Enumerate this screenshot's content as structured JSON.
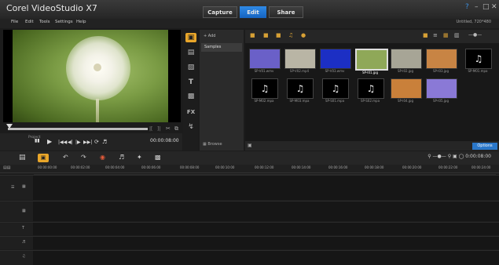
{
  "app": {
    "title": "Corel VideoStudio X7",
    "project_info": "Untitled, 720*480"
  },
  "window_controls": {
    "help": "?",
    "minimize": "–",
    "maximize": "□",
    "close": "✕"
  },
  "mode_tabs": {
    "capture": "Capture",
    "edit": "Edit",
    "share": "Share"
  },
  "menu": [
    "File",
    "Edit",
    "Tools",
    "Settings",
    "Help"
  ],
  "player": {
    "mode": "Project",
    "timecode": "00:00:08:00",
    "tools": [
      "|[",
      "]|",
      "✂",
      "⧉"
    ]
  },
  "library": {
    "add_label": "Add",
    "folder": "Samples",
    "browse_label": "Browse",
    "options_label": "Options",
    "row1": [
      {
        "name": "SP-V01.wmv",
        "color": "#6a60c8"
      },
      {
        "name": "SP-V02.mp4",
        "color": "#b9b5a5"
      },
      {
        "name": "SP-V03.wmv",
        "color": "#1c2fc4"
      },
      {
        "name": "SP-I01.jpg",
        "color": "#8fa858"
      },
      {
        "name": "SP-I02.jpg",
        "color": "#a7a596"
      },
      {
        "name": "SP-I03.jpg",
        "color": "#c88444"
      }
    ],
    "row1_audio": "SP-M01.mpa",
    "row2_audio": [
      "SP-M02.mpa",
      "SP-M03.mpa",
      "SP-S01.mpa",
      "SP-S02.mpa"
    ],
    "row2_images": [
      {
        "name": "SP-I04.jpg",
        "color": "#c9803a"
      },
      {
        "name": "SP-I05.jpg",
        "color": "#8a79d6"
      }
    ]
  },
  "timeline": {
    "ruler": [
      "00:00:00:00",
      "00:00:02:00",
      "00:00:04:00",
      "00:00:06:00",
      "00:00:08:00",
      "00:00:10:00",
      "00:00:12:00",
      "00:00:14:00",
      "00:00:16:00",
      "00:00:18:00",
      "00:00:20:00",
      "00:00:22:00",
      "00:00:24:00",
      "00:00:26:00"
    ],
    "zoom_time": "0:00:08:00",
    "tracks": [
      "Video",
      "Overlay",
      "Title",
      "Voice",
      "Music"
    ]
  }
}
